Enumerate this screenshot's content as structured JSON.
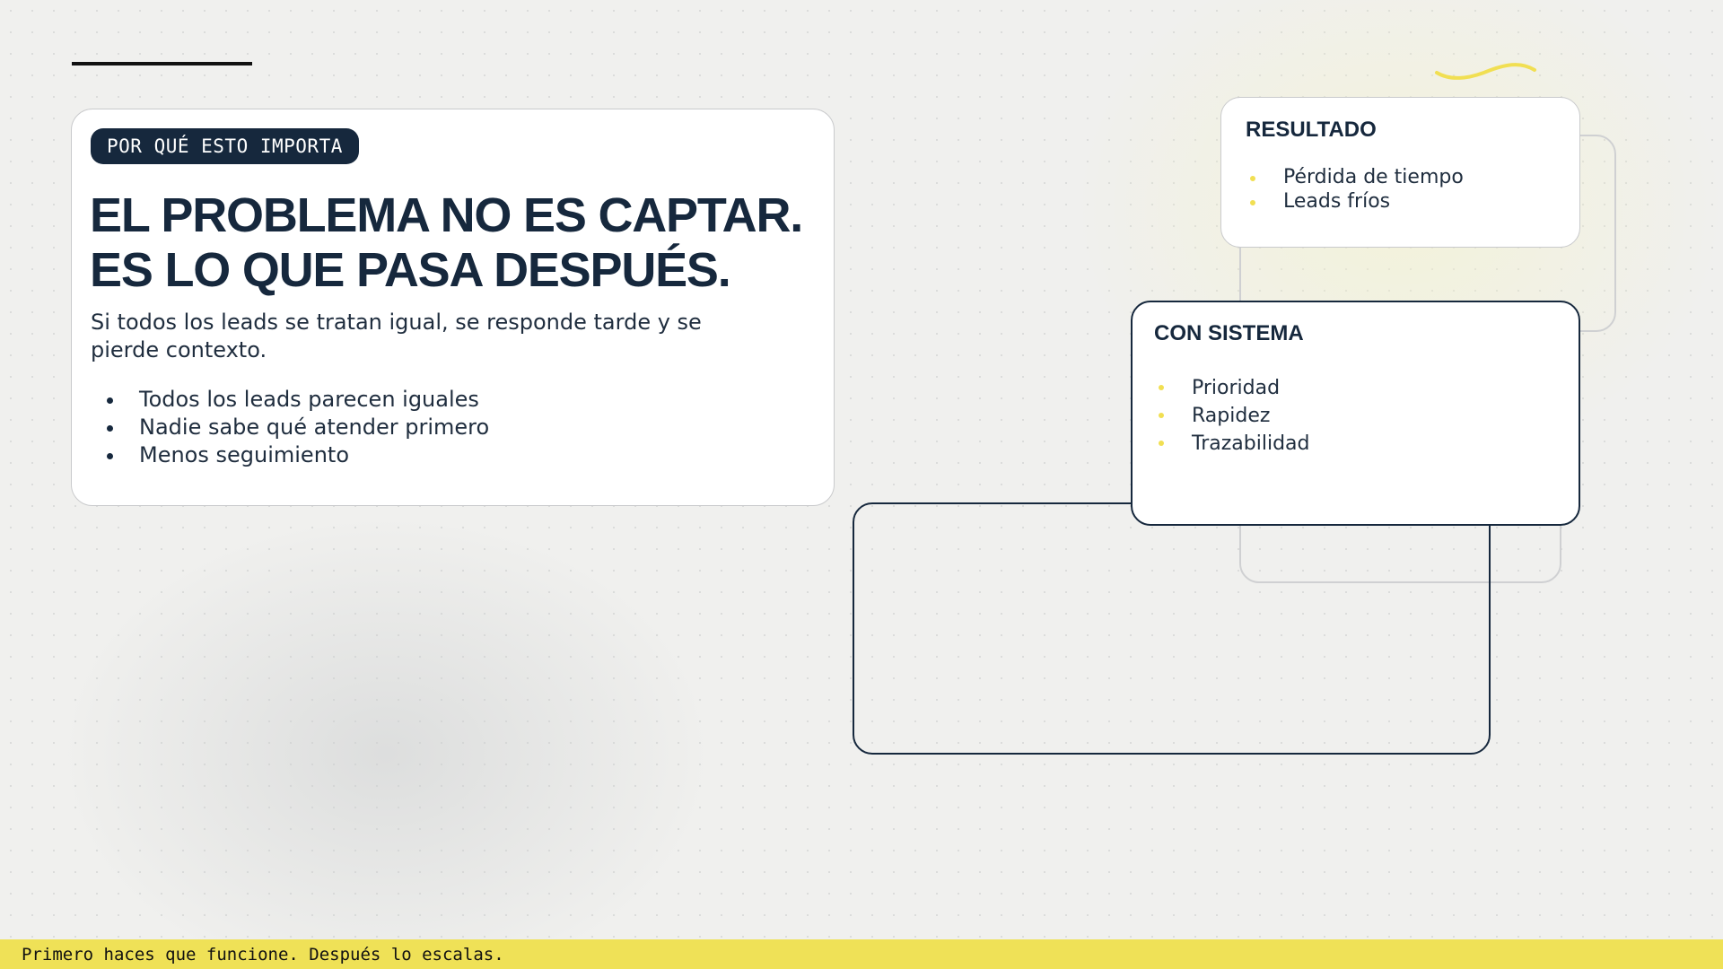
{
  "main_card": {
    "tag": "POR QUÉ ESTO IMPORTA",
    "headline_line1": "EL PROBLEMA NO ES CAPTAR.",
    "headline_line2": "ES LO QUE PASA DESPUÉS.",
    "lede": "Si todos los leads se tratan igual, se responde tarde y se pierde contexto.",
    "bullets": [
      "Todos los leads parecen iguales",
      "Nadie sabe qué atender primero",
      "Menos seguimiento"
    ]
  },
  "result_card": {
    "title": "RESULTADO",
    "items": [
      "Pérdida de tiempo",
      "Leads fríos"
    ]
  },
  "system_card": {
    "title": "CON SISTEMA",
    "items": [
      "Prioridad",
      "Rapidez",
      "Trazabilidad"
    ]
  },
  "footer": {
    "text": "Primero haces que funcione. Después lo escalas."
  },
  "colors": {
    "navy": "#16283d",
    "accent_yellow": "#efe157",
    "background": "#f0f0ee"
  }
}
